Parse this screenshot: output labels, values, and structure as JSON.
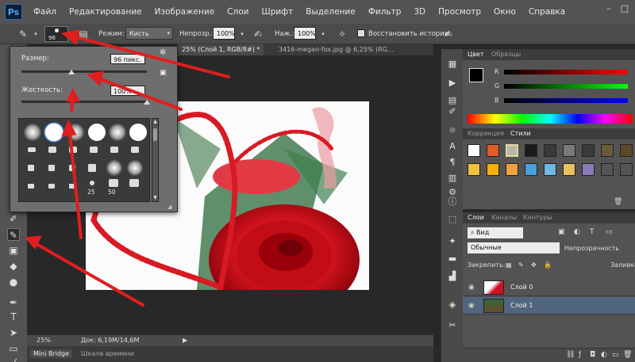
{
  "app": {
    "logo": "Ps"
  },
  "menu": [
    "Файл",
    "Редактирование",
    "Изображение",
    "Слои",
    "Шрифт",
    "Выделение",
    "Фильтр",
    "3D",
    "Просмотр",
    "Окно",
    "Справка"
  ],
  "window_controls": [
    "–",
    "□"
  ],
  "options": {
    "brush_size": "96",
    "mode_label": "Режим:",
    "mode_value": "Кисть",
    "opacity_label": "Непрозр.:",
    "opacity_value": "100%",
    "pressure_label": "Наж.:",
    "pressure_value": "100%",
    "restore_history": "Восстановить историю"
  },
  "tabs": [
    {
      "label": "25% (Слой 1, RGB/8#) *",
      "active": true
    },
    {
      "label": "3416-megan-fox.jpg @ 6,25% (RG...",
      "active": false
    }
  ],
  "brush_popup": {
    "size_label": "Размер:",
    "size_value": "96 пикс.",
    "size_level": 0.4,
    "hardness_label": "Жесткость:",
    "hardness_value": "100%",
    "hardness_level": 1.0,
    "preset_labels": [
      "25",
      "50"
    ]
  },
  "status": {
    "zoom": "25%",
    "doc_info": "Док: 6,19M/14,6M"
  },
  "bottom_tabs": [
    "Mini Bridge",
    "Шкала времени"
  ],
  "color_panel": {
    "tabs": [
      "Цвет",
      "Образцы"
    ],
    "channels": [
      "R",
      "G",
      "B"
    ],
    "foreground": "#000000",
    "background": "#ffffff"
  },
  "styles_panel": {
    "tabs": [
      "Коррекция",
      "Стили"
    ]
  },
  "layers_panel": {
    "tabs": [
      "Слои",
      "Каналы",
      "Контуры"
    ],
    "kind_filter": "Вид",
    "blend_mode": "Обычные",
    "opacity_label": "Непрозрачность",
    "lock_label": "Закрепить:",
    "fill_label": "Заливка",
    "layers": [
      {
        "name": "Слой 0",
        "selected": false
      },
      {
        "name": "Слой 1",
        "selected": true
      }
    ]
  },
  "colors": {
    "arrow": "#e01e1e",
    "accent_selected": "#52657e",
    "panel_bg": "#535353"
  }
}
